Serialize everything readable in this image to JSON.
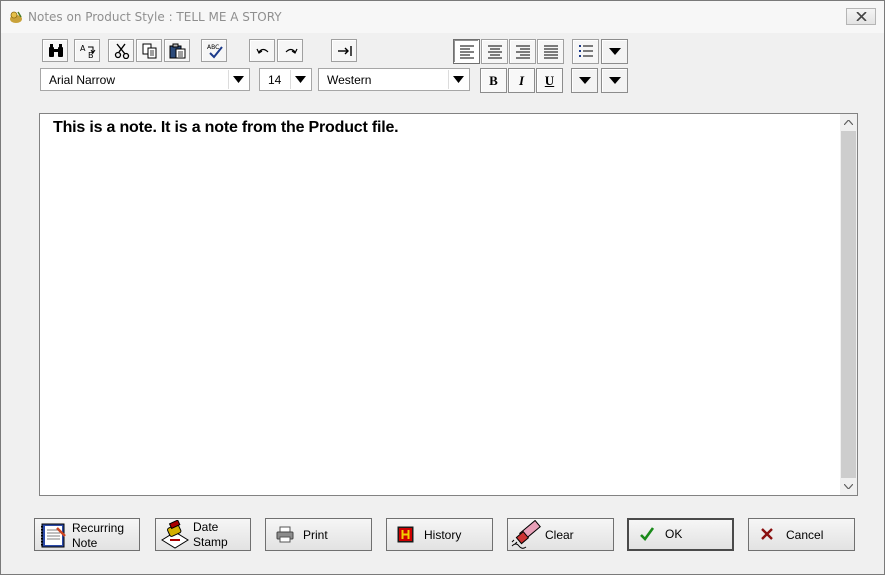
{
  "window": {
    "title": "Notes on Product Style : TELL ME A STORY"
  },
  "toolbar": {
    "font": "Arial Narrow",
    "size": "14",
    "script": "Western",
    "bold_label": "B",
    "italic_label": "I",
    "underline_label": "U"
  },
  "note": {
    "text": "This is a note.  It is a note from the Product file."
  },
  "buttons": {
    "recurring_1": "Recurring",
    "recurring_2": "Note",
    "date_1": "Date",
    "date_2": "Stamp",
    "print": "Print",
    "history": "History",
    "clear": "Clear",
    "ok": "OK",
    "cancel": "Cancel"
  },
  "colors": {
    "window_bg": "#f0f0f0",
    "title_text": "#8f8f8f",
    "accent_green": "#1a8a1a",
    "cancel_red": "#8a1010",
    "history_red": "#cc0000"
  }
}
